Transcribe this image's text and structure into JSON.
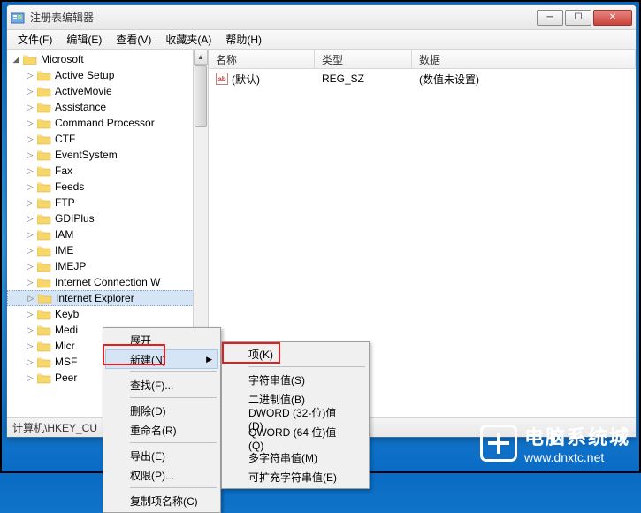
{
  "window": {
    "title": "注册表编辑器"
  },
  "menubar": [
    "文件(F)",
    "编辑(E)",
    "查看(V)",
    "收藏夹(A)",
    "帮助(H)"
  ],
  "tree": {
    "root": "Microsoft",
    "items": [
      "Active Setup",
      "ActiveMovie",
      "Assistance",
      "Command Processor",
      "CTF",
      "EventSystem",
      "Fax",
      "Feeds",
      "FTP",
      "GDIPlus",
      "IAM",
      "IME",
      "IMEJP",
      "Internet Connection W",
      "Internet Explorer",
      "Keyb",
      "Medi",
      "Micr",
      "MSF",
      "Peer"
    ],
    "selected_index": 14
  },
  "list": {
    "columns": {
      "name": "名称",
      "type": "类型",
      "data": "数据"
    },
    "rows": [
      {
        "name": "(默认)",
        "type": "REG_SZ",
        "data": "(数值未设置)"
      }
    ]
  },
  "statusbar": "计算机\\HKEY_CU",
  "context_menu_1": {
    "items": [
      {
        "label": "展开",
        "enabled": true
      },
      {
        "label": "新建(N)",
        "enabled": true,
        "submenu": true,
        "hover": true
      },
      {
        "sep": true
      },
      {
        "label": "查找(F)...",
        "enabled": true
      },
      {
        "sep": true
      },
      {
        "label": "删除(D)",
        "enabled": true
      },
      {
        "label": "重命名(R)",
        "enabled": true
      },
      {
        "sep": true
      },
      {
        "label": "导出(E)",
        "enabled": true
      },
      {
        "label": "权限(P)...",
        "enabled": true
      },
      {
        "sep": true
      },
      {
        "label": "复制项名称(C)",
        "enabled": true
      }
    ]
  },
  "context_menu_2": {
    "items": [
      {
        "label": "项(K)",
        "enabled": true
      },
      {
        "sep": true
      },
      {
        "label": "字符串值(S)",
        "enabled": true
      },
      {
        "label": "二进制值(B)",
        "enabled": true
      },
      {
        "label": "DWORD (32-位)值(D)",
        "enabled": true
      },
      {
        "label": "QWORD (64 位)值(Q)",
        "enabled": true
      },
      {
        "label": "多字符串值(M)",
        "enabled": true
      },
      {
        "label": "可扩充字符串值(E)",
        "enabled": true
      }
    ]
  },
  "watermark": {
    "text": "电脑系统城",
    "url": "www.dnxtc.net"
  }
}
